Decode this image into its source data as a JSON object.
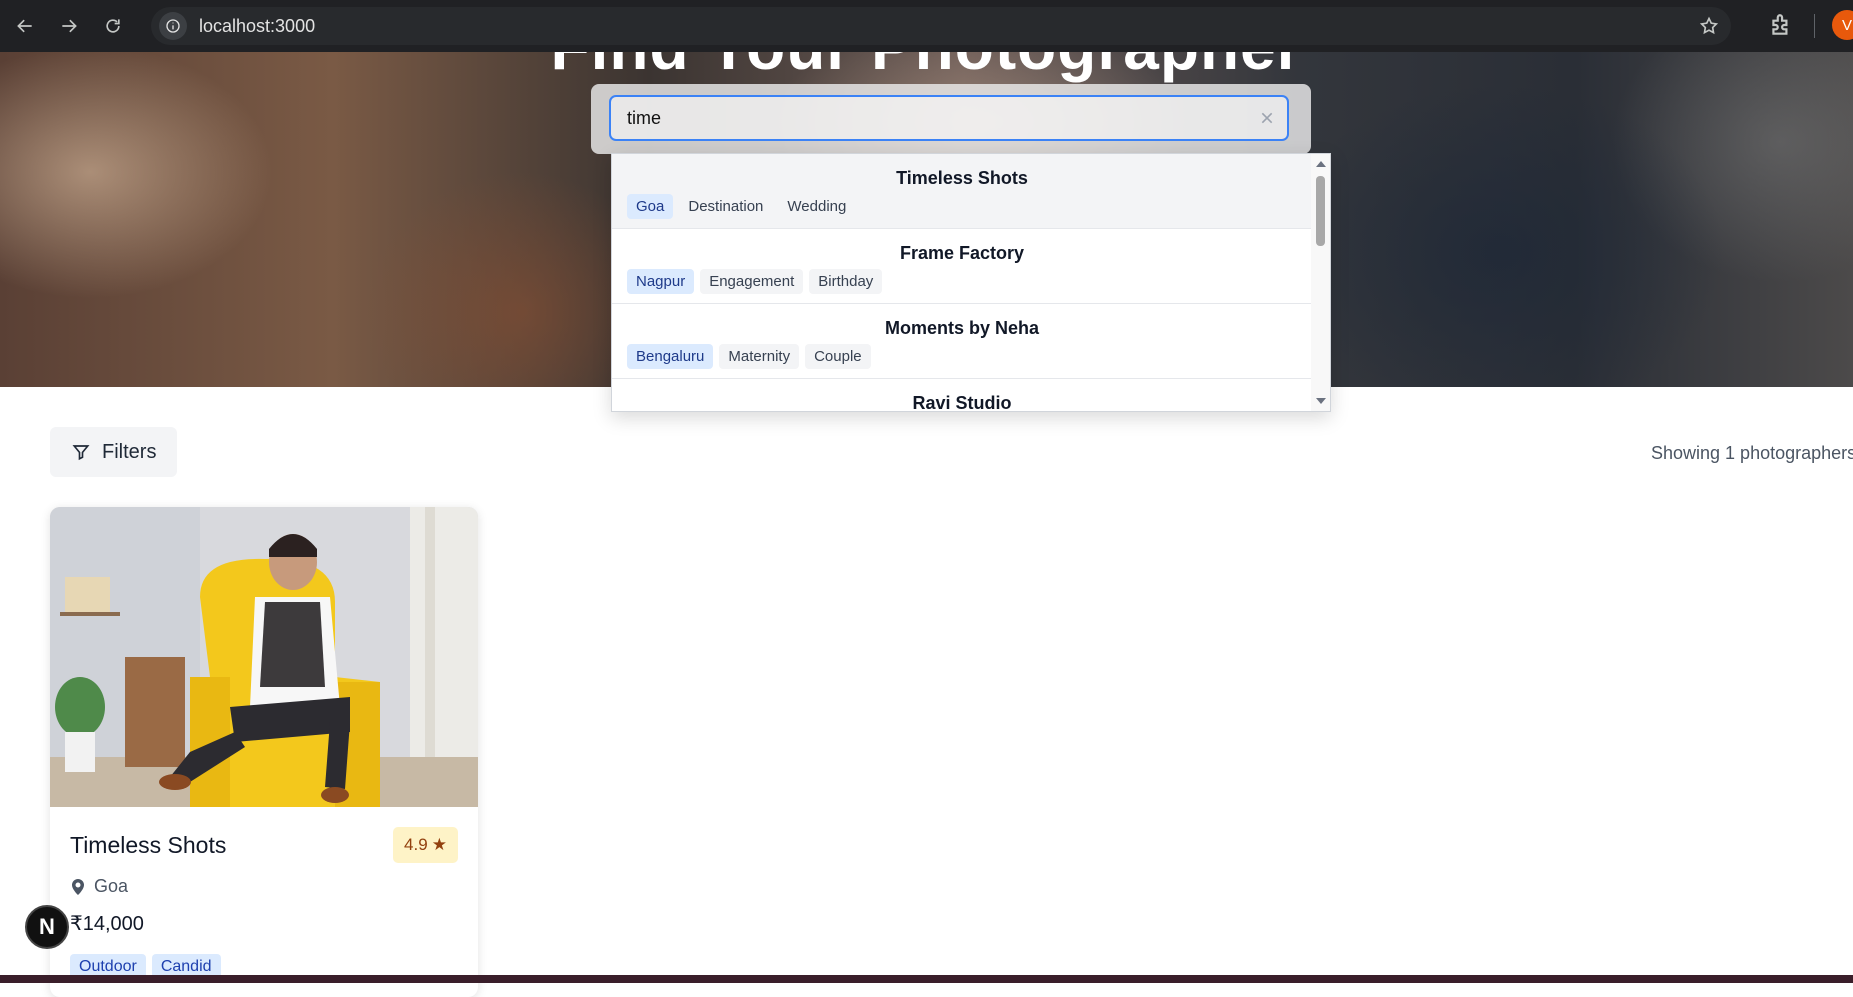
{
  "browser": {
    "url": "localhost:3000",
    "profile_initial": "V"
  },
  "hero": {
    "title": "Find Your Photographer"
  },
  "search": {
    "value": "time",
    "clear_icon": "close-icon"
  },
  "dropdown": {
    "items": [
      {
        "name": "Timeless Shots",
        "location": "Goa",
        "tags": [
          "Destination",
          "Wedding"
        ]
      },
      {
        "name": "Frame Factory",
        "location": "Nagpur",
        "tags": [
          "Engagement",
          "Birthday"
        ]
      },
      {
        "name": "Moments by Neha",
        "location": "Bengaluru",
        "tags": [
          "Maternity",
          "Couple"
        ]
      },
      {
        "name": "Ravi Studio",
        "location": "",
        "tags": []
      }
    ]
  },
  "toolbar": {
    "filters_label": "Filters",
    "result_count": "Showing 1 photographers"
  },
  "card": {
    "name": "Timeless Shots",
    "rating": "4.9",
    "rating_star": "★",
    "location": "Goa",
    "price": "₹14,000",
    "tags": [
      "Outdoor",
      "Candid"
    ]
  },
  "dev_badge": "N",
  "colors": {
    "accent": "#3b82f6",
    "location_tag_bg": "#dbeafe",
    "rating_bg": "#fef3c7"
  }
}
